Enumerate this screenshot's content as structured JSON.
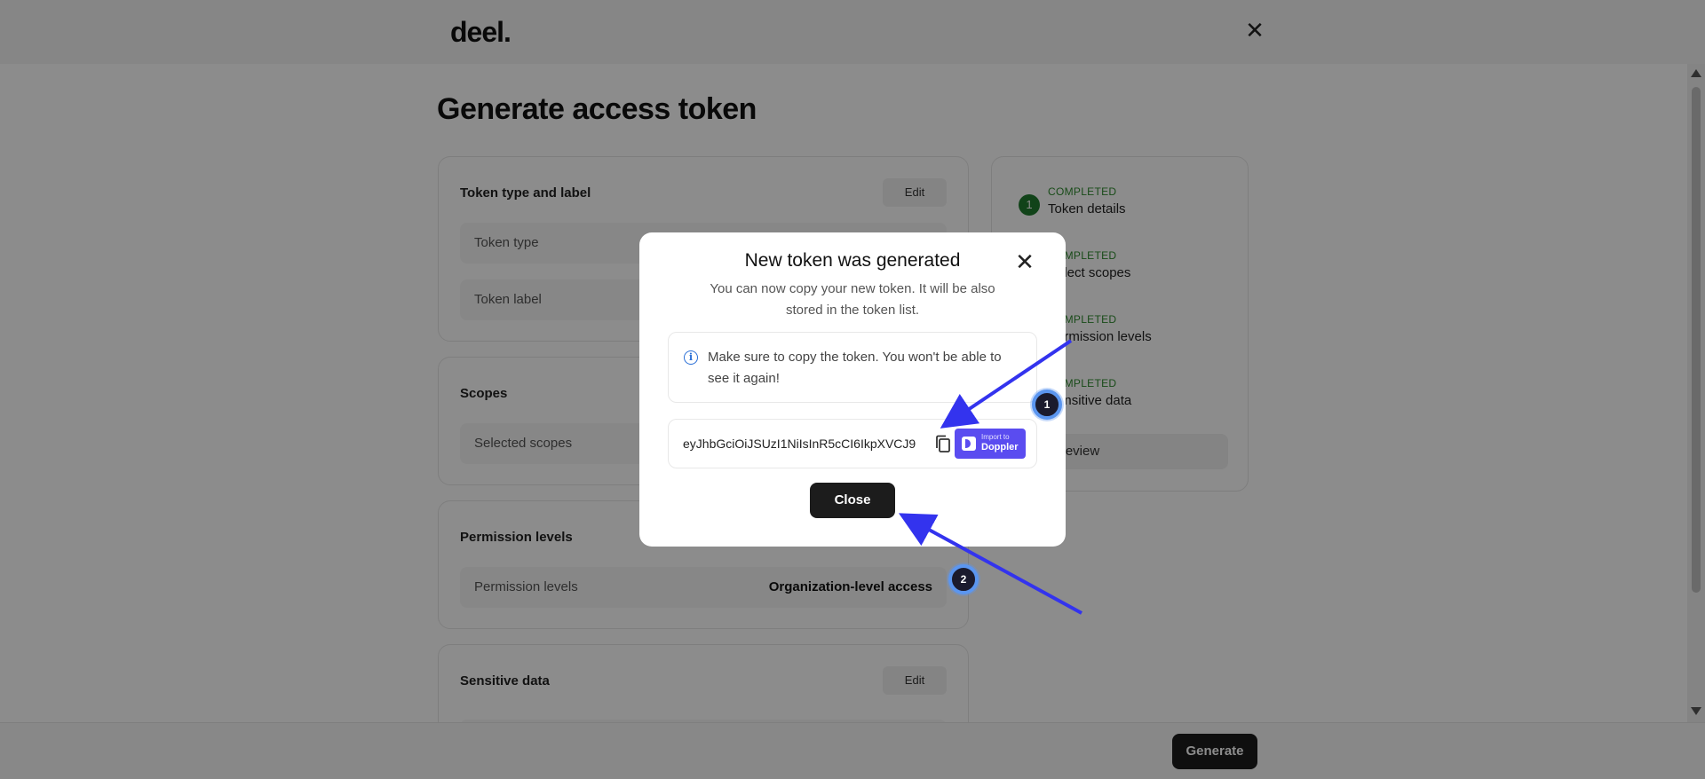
{
  "app": {
    "logo": "deel.",
    "page_title": "Generate access token"
  },
  "cards": {
    "token_type_label": {
      "title": "Token type and label",
      "edit_label": "Edit",
      "rows": [
        {
          "label": "Token type"
        },
        {
          "label": "Token label"
        }
      ]
    },
    "scopes": {
      "title": "Scopes",
      "rows": [
        {
          "label": "Selected scopes"
        }
      ]
    },
    "permission_levels": {
      "title": "Permission levels",
      "rows": [
        {
          "label": "Permission levels",
          "value": "Organization-level access"
        }
      ]
    },
    "sensitive_data": {
      "title": "Sensitive data",
      "edit_label": "Edit"
    }
  },
  "steps": [
    {
      "number": "1",
      "status": "COMPLETED",
      "label": "Token details"
    },
    {
      "status": "COMPLETED",
      "label": "Select scopes"
    },
    {
      "status": "COMPLETED",
      "label": "Permission levels"
    },
    {
      "status": "COMPLETED",
      "label": "Sensitive data"
    }
  ],
  "review_label": "Review",
  "footer": {
    "generate_label": "Generate"
  },
  "modal": {
    "title": "New token was generated",
    "subtitle": "You can now copy your new token. It will be also stored in the token list.",
    "info_text": "Make sure to copy the token. You won't be able to see it again!",
    "token_value": "eyJhbGciOiJSUzI1NiIsInR5cCI6IkpXVCJ9",
    "doppler_small": "Import to",
    "doppler_name": "Doppler",
    "close_label": "Close"
  },
  "annotations": [
    {
      "number": "1"
    },
    {
      "number": "2"
    }
  ],
  "colors": {
    "accent_dark": "#1c1c1c",
    "completed_green": "#2f8a2f",
    "annotation_blue": "#3333ee",
    "doppler_purple": "#5a4cf0",
    "info_blue": "#2a6fd6"
  }
}
